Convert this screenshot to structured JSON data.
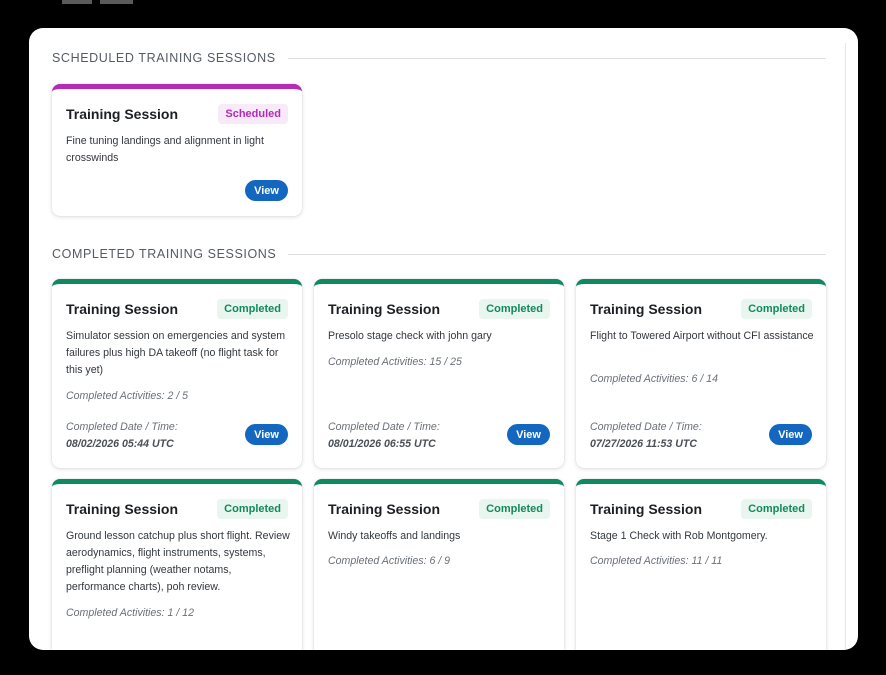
{
  "sections": {
    "scheduled_title": "SCHEDULED TRAINING SESSIONS",
    "completed_title": "COMPLETED TRAINING SESSIONS"
  },
  "scheduled": [
    {
      "title": "Training Session",
      "status": "Scheduled",
      "description": "Fine tuning landings and alignment in light crosswinds",
      "view_label": "View"
    }
  ],
  "completed": [
    {
      "title": "Training Session",
      "status": "Completed",
      "description": "Simulator session on emergencies and system failures plus high DA takeoff (no flight task for this yet)",
      "activities": "Completed Activities: 2 / 5",
      "date_label": "Completed Date / Time:",
      "date_value": "08/02/2026 05:44 UTC",
      "view_label": "View"
    },
    {
      "title": "Training Session",
      "status": "Completed",
      "description": "Presolo stage check with john gary",
      "activities": "Completed Activities: 15 / 25",
      "date_label": "Completed Date / Time:",
      "date_value": "08/01/2026 06:55 UTC",
      "view_label": "View"
    },
    {
      "title": "Training Session",
      "status": "Completed",
      "description": "Flight to Towered Airport without CFI assistance",
      "activities": "Completed Activities: 6 / 14",
      "date_label": "Completed Date / Time:",
      "date_value": "07/27/2026 11:53 UTC",
      "view_label": "View"
    },
    {
      "title": "Training Session",
      "status": "Completed",
      "description": "Ground lesson catchup plus short flight. Review aerodynamics, flight instruments, systems, preflight planning (weather notams, performance charts), poh review.",
      "activities": "Completed Activities: 1 / 12"
    },
    {
      "title": "Training Session",
      "status": "Completed",
      "description": "Windy takeoffs and landings",
      "activities": "Completed Activities: 6 / 9"
    },
    {
      "title": "Training Session",
      "status": "Completed",
      "description": "Stage 1 Check with Rob Montgomery.",
      "activities": "Completed Activities: 11 / 11"
    }
  ]
}
